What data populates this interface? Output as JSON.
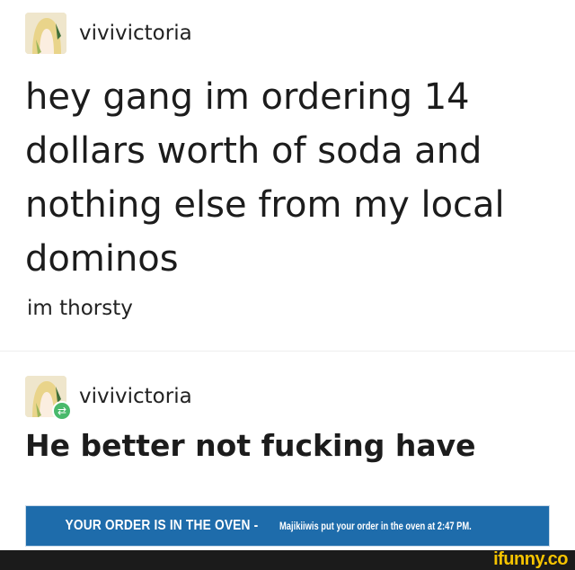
{
  "post1": {
    "username": "vivivictoria",
    "avatar_icon": "anime-avatar",
    "headline": "hey gang im ordering 14 dollars worth of soda and nothing else from my local dominos",
    "subtext": "im thorsty"
  },
  "post2": {
    "username": "vivivictoria",
    "avatar_icon": "anime-avatar",
    "badge_icon": "reblog-icon",
    "reply": "He better not fucking have"
  },
  "banner": {
    "main": "YOUR ORDER IS IN THE OVEN -",
    "sub": "Majikiiwis put your order in the oven at 2:47 PM."
  },
  "footer": {
    "watermark": "ifunny.co"
  },
  "colors": {
    "banner_bg": "#1e6cab",
    "reblog_badge": "#49b96b",
    "watermark": "#f6c400"
  }
}
